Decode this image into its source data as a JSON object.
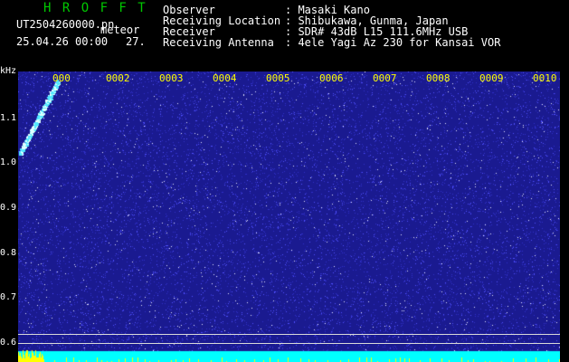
{
  "app": {
    "title": "H R O F F T",
    "file_name": "UT2504260000.pn",
    "file_tag": "meteor",
    "timestamp": "25.04.26 00:00",
    "timestamp_num": "27."
  },
  "meta": [
    {
      "label": "Observer",
      "value": ": Masaki Kano"
    },
    {
      "label": "Receiving Location",
      "value": ": Shibukawa, Gunma, Japan"
    },
    {
      "label": "Receiver",
      "value": ": SDR# 43dB L15 111.6MHz USB"
    },
    {
      "label": "Receiving Antenna",
      "value": ": 4ele Yagi Az 230 for Kansai VOR"
    }
  ],
  "spectrogram": {
    "y_unit": "kHz",
    "y_ticks": [
      "1.1",
      "1.0",
      "0.9",
      "0.8",
      "0.7",
      "0.6"
    ],
    "x_ticks": [
      "000",
      "0002",
      "0003",
      "0004",
      "0005",
      "0006",
      "0007",
      "0008",
      "0009",
      "0010"
    ],
    "colors": {
      "background": "#1a1a90",
      "noise": "#5050ff",
      "bottom_band": "#00ffff",
      "meteor_echo": "#ffff00",
      "tick_label": "#ffff00"
    }
  }
}
